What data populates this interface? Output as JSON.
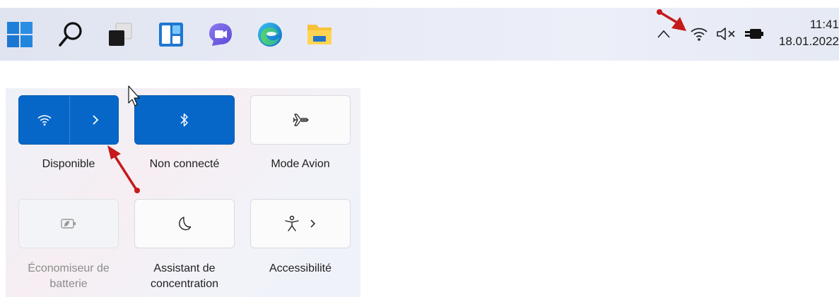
{
  "taskbar": {
    "apps": [
      {
        "name": "start-icon"
      },
      {
        "name": "search-icon"
      },
      {
        "name": "task-view-icon"
      },
      {
        "name": "widgets-icon"
      },
      {
        "name": "chat-icon"
      },
      {
        "name": "edge-icon"
      },
      {
        "name": "file-explorer-icon"
      }
    ],
    "tray": {
      "overflow_icon": "chevron-up-icon",
      "wifi_icon": "wifi-icon",
      "volume_icon": "volume-muted-icon",
      "battery_icon": "battery-charging-icon"
    },
    "clock": {
      "time": "11:41",
      "date": "18.01.2022"
    }
  },
  "quick_settings": {
    "tiles": [
      {
        "id": "wifi",
        "label": "Disponible",
        "icon": "wifi-icon",
        "state": "on",
        "has_chevron": true
      },
      {
        "id": "bluetooth",
        "label": "Non connecté",
        "icon": "bluetooth-icon",
        "state": "on"
      },
      {
        "id": "airplane",
        "label": "Mode Avion",
        "icon": "airplane-icon",
        "state": "off"
      },
      {
        "id": "battery_saver",
        "label": "Économiseur de batterie",
        "icon": "battery-saver-icon",
        "state": "disabled"
      },
      {
        "id": "focus",
        "label": "Assistant de concentration",
        "icon": "moon-icon",
        "state": "off"
      },
      {
        "id": "accessibility",
        "label": "Accessibilité",
        "icon": "accessibility-icon",
        "state": "off",
        "has_chevron": true
      }
    ]
  },
  "colors": {
    "accent": "#0667c8",
    "annotation_arrow": "#c41a1a"
  }
}
